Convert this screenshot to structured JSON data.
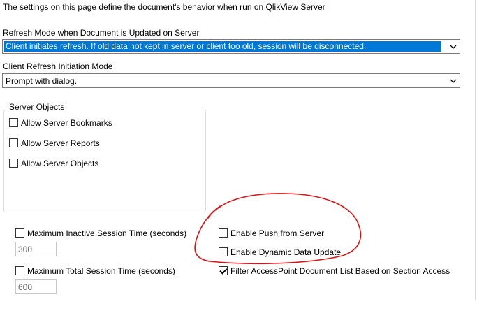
{
  "header": {
    "description": "The settings on this page define the document's behavior when run on QlikView Server"
  },
  "refresh_mode": {
    "label": "Refresh Mode when Document is Updated on Server",
    "selected": "Client initiates refresh. If old data not kept in server or client too old, session will be disconnected."
  },
  "client_refresh": {
    "label": "Client Refresh Initiation Mode",
    "selected": "Prompt with dialog."
  },
  "server_objects": {
    "title": "Server Objects",
    "items": [
      {
        "label": "Allow Server Bookmarks",
        "checked": false
      },
      {
        "label": "Allow Server Reports",
        "checked": false
      },
      {
        "label": "Allow Server Objects",
        "checked": false
      }
    ]
  },
  "session": {
    "max_inactive_label": "Maximum Inactive Session Time (seconds)",
    "max_inactive_checked": false,
    "max_inactive_value": "300",
    "max_total_label": "Maximum Total Session Time (seconds)",
    "max_total_checked": false,
    "max_total_value": "600"
  },
  "options": {
    "push_label": "Enable Push from Server",
    "push_checked": false,
    "dynamic_label": "Enable Dynamic Data Update",
    "dynamic_checked": false,
    "filter_label": "Filter AccessPoint Document List Based on Section Access",
    "filter_checked": true
  },
  "colors": {
    "selection": "#0078d7",
    "annotation": "#e01010"
  },
  "icons": {
    "dropdown": "chevron-down-icon",
    "annotation": "red-circle-annotation"
  }
}
